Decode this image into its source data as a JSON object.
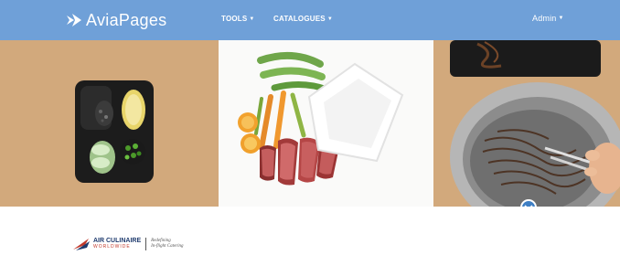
{
  "navbar": {
    "brand": "AviaPages",
    "items": [
      {
        "label": "TOOLS"
      },
      {
        "label": "CATALOGUES"
      }
    ],
    "user_menu": "Admin"
  },
  "hero": {
    "icon": "food-photo-banner"
  },
  "scroll": {
    "icon": "chevron-down-icon"
  },
  "partner_logo": {
    "name_line1": "AIR CULINAIRE",
    "name_line2": "WORLDWIDE",
    "tagline_line1": "Redefining",
    "tagline_line2": "In-flight Catering"
  },
  "colors": {
    "navbar": "#6fa0d8",
    "accent": "#3f7fc4"
  }
}
